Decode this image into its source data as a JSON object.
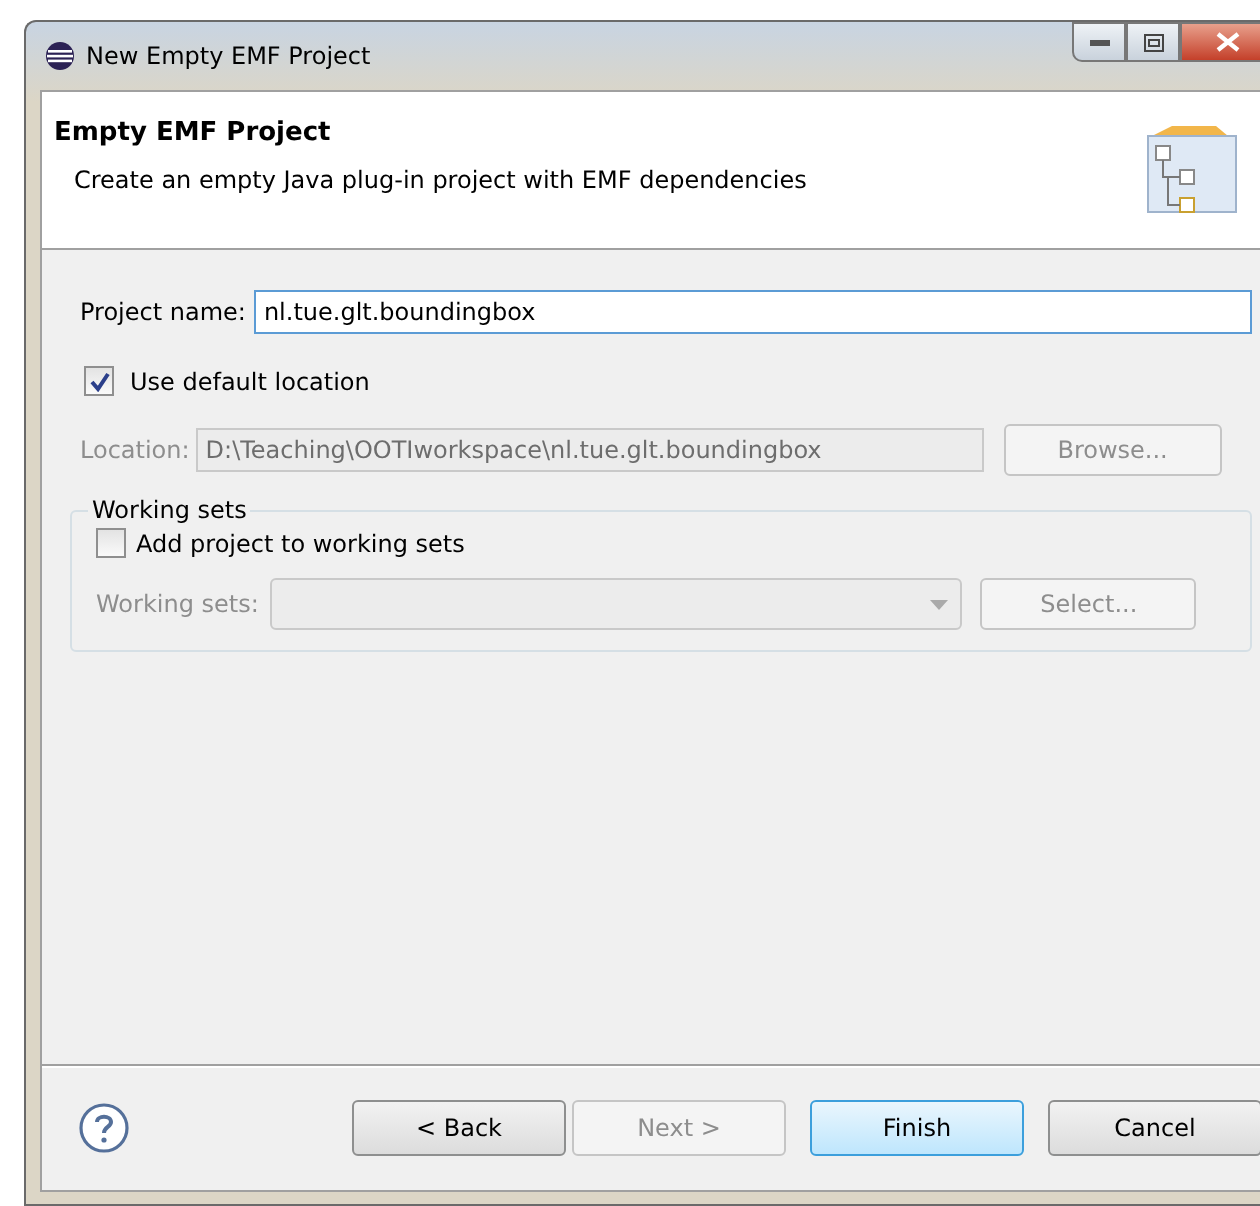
{
  "window": {
    "title": "New Empty EMF Project"
  },
  "header": {
    "title": "Empty EMF Project",
    "description": "Create an empty Java plug-in project with EMF dependencies"
  },
  "project_name": {
    "label": "Project name:",
    "value": "nl.tue.glt.boundingbox"
  },
  "use_default_location": {
    "label": "Use default location",
    "checked": true
  },
  "location": {
    "label": "Location:",
    "value": "D:\\Teaching\\OOTIworkspace\\nl.tue.glt.boundingbox",
    "disabled": true,
    "button": {
      "label": "Browse...",
      "disabled": true
    }
  },
  "working_sets": {
    "title": "Working sets",
    "add": {
      "label": "Add project to working sets",
      "checked": false
    },
    "field_label": "Working sets:",
    "disabled": true,
    "button": {
      "label": "Select...",
      "disabled": true
    }
  },
  "buttons": [
    {
      "label": "< Back",
      "disabled": false,
      "default": false
    },
    {
      "label": "Next >",
      "disabled": true,
      "default": false
    },
    {
      "label": "Finish",
      "disabled": false,
      "default": true
    },
    {
      "label": "Cancel",
      "disabled": false,
      "default": false
    }
  ]
}
